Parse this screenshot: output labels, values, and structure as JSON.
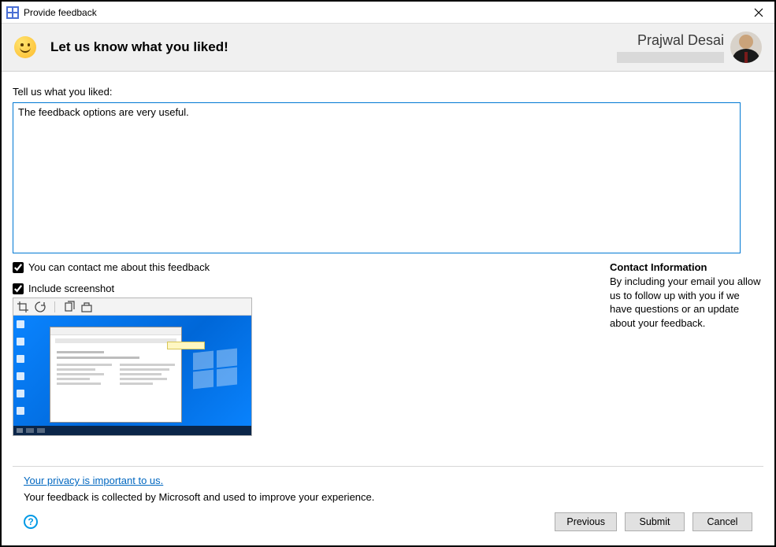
{
  "window": {
    "title": "Provide feedback"
  },
  "header": {
    "heading": "Let us know what you liked!",
    "user_name": "Prajwal Desai"
  },
  "form": {
    "prompt_label": "Tell us what you liked:",
    "textarea_value": "The feedback options are very useful.",
    "contact_checkbox_label": "You can contact me about this feedback",
    "contact_checked": true,
    "screenshot_checkbox_label": "Include screenshot",
    "screenshot_checked": true
  },
  "contact_info": {
    "title": "Contact Information",
    "body": "By including your email you allow us to follow up with you if we have questions or an update about your feedback."
  },
  "privacy": {
    "link": "Your privacy is important to us.",
    "text": "Your feedback is collected by Microsoft and used to improve your experience."
  },
  "buttons": {
    "previous": "Previous",
    "submit": "Submit",
    "cancel": "Cancel"
  },
  "icons": {
    "help": "?"
  }
}
